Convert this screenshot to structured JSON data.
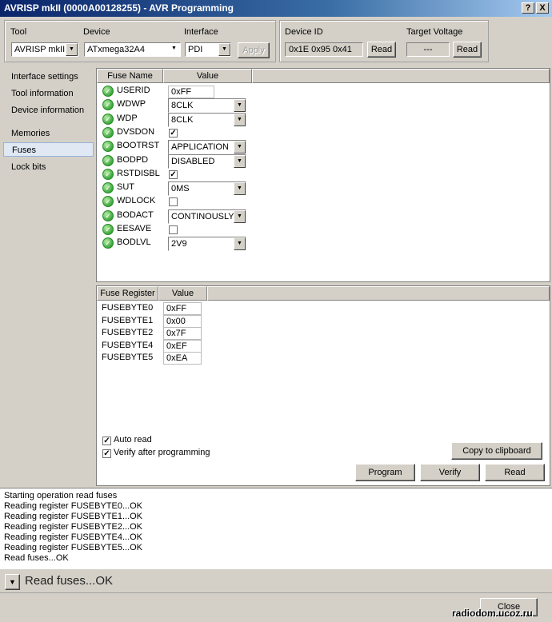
{
  "window": {
    "title": "AVRISP mkII (0000A00128255) - AVR Programming",
    "help_btn": "?",
    "close_btn": "X"
  },
  "toolbar": {
    "tool_label": "Tool",
    "tool_value": "AVRISP mkII",
    "device_label": "Device",
    "device_value": "ATxmega32A4",
    "interface_label": "Interface",
    "interface_value": "PDI",
    "apply_label": "Apply",
    "device_id_label": "Device ID",
    "device_id_value": "0x1E 0x95 0x41",
    "device_id_read": "Read",
    "voltage_label": "Target Voltage",
    "voltage_value": "---",
    "voltage_read": "Read"
  },
  "nav": [
    {
      "label": "Interface settings"
    },
    {
      "label": "Tool information"
    },
    {
      "label": "Device information"
    },
    {
      "label": "Memories"
    },
    {
      "label": "Fuses",
      "selected": true
    },
    {
      "label": "Lock bits"
    }
  ],
  "fuse_table": {
    "col_name": "Fuse Name",
    "col_value": "Value",
    "rows": [
      {
        "name": "USERID",
        "type": "text",
        "value": "0xFF"
      },
      {
        "name": "WDWP",
        "type": "combo",
        "value": "8CLK"
      },
      {
        "name": "WDP",
        "type": "combo",
        "value": "8CLK"
      },
      {
        "name": "DVSDON",
        "type": "check",
        "value": "checked"
      },
      {
        "name": "BOOTRST",
        "type": "combo",
        "value": "APPLICATION"
      },
      {
        "name": "BODPD",
        "type": "combo",
        "value": "DISABLED"
      },
      {
        "name": "RSTDISBL",
        "type": "check",
        "value": "checked"
      },
      {
        "name": "SUT",
        "type": "combo",
        "value": "0MS"
      },
      {
        "name": "WDLOCK",
        "type": "check",
        "value": "unchecked"
      },
      {
        "name": "BODACT",
        "type": "combo",
        "value": "CONTINOUSLY"
      },
      {
        "name": "EESAVE",
        "type": "check",
        "value": "unchecked"
      },
      {
        "name": "BODLVL",
        "type": "combo",
        "value": "2V9"
      }
    ]
  },
  "register_table": {
    "col_name": "Fuse Register",
    "col_value": "Value",
    "rows": [
      {
        "name": "FUSEBYTE0",
        "value": "0xFF"
      },
      {
        "name": "FUSEBYTE1",
        "value": "0x00"
      },
      {
        "name": "FUSEBYTE2",
        "value": "0x7F"
      },
      {
        "name": "FUSEBYTE4",
        "value": "0xEF"
      },
      {
        "name": "FUSEBYTE5",
        "value": "0xEA"
      }
    ]
  },
  "options": {
    "auto_read": "Auto read",
    "verify_after": "Verify after programming"
  },
  "actions": {
    "copy": "Copy to clipboard",
    "program": "Program",
    "verify": "Verify",
    "read": "Read"
  },
  "log": [
    "Starting operation read fuses",
    "Reading register FUSEBYTE0...OK",
    "Reading register FUSEBYTE1...OK",
    "Reading register FUSEBYTE2...OK",
    "Reading register FUSEBYTE4...OK",
    "Reading register FUSEBYTE5...OK",
    "Read fuses...OK"
  ],
  "status": {
    "text": "Read fuses...OK",
    "close": "Close"
  },
  "watermark": "radiodom.ucoz.ru"
}
